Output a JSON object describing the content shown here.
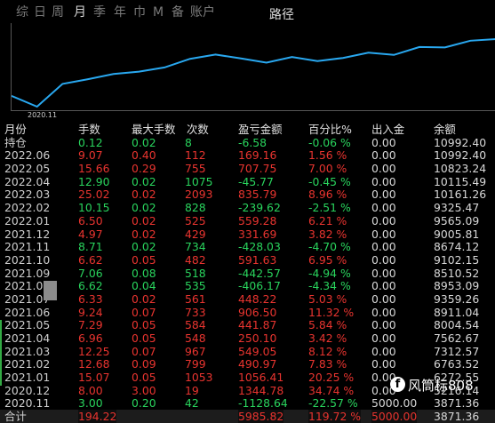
{
  "tabs": [
    "综",
    "日",
    "周",
    "月",
    "季",
    "年",
    "巾",
    "M",
    "备",
    "账户"
  ],
  "active_tab": "月",
  "route_label": "路径",
  "chart_data": {
    "type": "line",
    "x_tick_label": "2020.11",
    "color": "#29a8f0",
    "values": [
      5000.0,
      3871.36,
      6272.55,
      6763.52,
      7312.57,
      7562.67,
      8004.54,
      8911.04,
      9359.26,
      8953.09,
      8510.52,
      9102.15,
      8674.12,
      9005.81,
      9565.09,
      9325.47,
      10161.26,
      10115.49,
      10823.24,
      10992.4
    ]
  },
  "table": {
    "headers": [
      "月份",
      "手数",
      "最大手数",
      "次数",
      "盈亏金额",
      "百分比%",
      "出入金",
      "余额"
    ],
    "rows": [
      {
        "month": "持仓",
        "lots": "0.12",
        "maxlots": "0.02",
        "count": "8",
        "pnl": "-6.58",
        "pct": "-0.06 %",
        "io": "0.00",
        "balance": "10992.40",
        "sign": "neg"
      },
      {
        "month": "2022.06",
        "lots": "9.07",
        "maxlots": "0.40",
        "count": "112",
        "pnl": "169.16",
        "pct": "1.56 %",
        "io": "0.00",
        "balance": "10992.40",
        "sign": "pos"
      },
      {
        "month": "2022.05",
        "lots": "15.66",
        "maxlots": "0.29",
        "count": "755",
        "pnl": "707.75",
        "pct": "7.00 %",
        "io": "0.00",
        "balance": "10823.24",
        "sign": "pos"
      },
      {
        "month": "2022.04",
        "lots": "12.90",
        "maxlots": "0.02",
        "count": "1075",
        "pnl": "-45.77",
        "pct": "-0.45 %",
        "io": "0.00",
        "balance": "10115.49",
        "sign": "neg"
      },
      {
        "month": "2022.03",
        "lots": "25.02",
        "maxlots": "0.02",
        "count": "2093",
        "pnl": "835.79",
        "pct": "8.96 %",
        "io": "0.00",
        "balance": "10161.26",
        "sign": "pos"
      },
      {
        "month": "2022.02",
        "lots": "10.15",
        "maxlots": "0.02",
        "count": "828",
        "pnl": "-239.62",
        "pct": "-2.51 %",
        "io": "0.00",
        "balance": "9325.47",
        "sign": "neg"
      },
      {
        "month": "2022.01",
        "lots": "6.50",
        "maxlots": "0.02",
        "count": "525",
        "pnl": "559.28",
        "pct": "6.21 %",
        "io": "0.00",
        "balance": "9565.09",
        "sign": "pos"
      },
      {
        "month": "2021.12",
        "lots": "4.97",
        "maxlots": "0.02",
        "count": "429",
        "pnl": "331.69",
        "pct": "3.82 %",
        "io": "0.00",
        "balance": "9005.81",
        "sign": "pos"
      },
      {
        "month": "2021.11",
        "lots": "8.71",
        "maxlots": "0.02",
        "count": "734",
        "pnl": "-428.03",
        "pct": "-4.70 %",
        "io": "0.00",
        "balance": "8674.12",
        "sign": "neg"
      },
      {
        "month": "2021.10",
        "lots": "6.62",
        "maxlots": "0.05",
        "count": "482",
        "pnl": "591.63",
        "pct": "6.95 %",
        "io": "0.00",
        "balance": "9102.15",
        "sign": "pos"
      },
      {
        "month": "2021.09",
        "lots": "7.06",
        "maxlots": "0.08",
        "count": "518",
        "pnl": "-442.57",
        "pct": "-4.94 %",
        "io": "0.00",
        "balance": "8510.52",
        "sign": "neg"
      },
      {
        "month": "2021.08",
        "lots": "6.62",
        "maxlots": "0.04",
        "count": "535",
        "pnl": "-406.17",
        "pct": "-4.34 %",
        "io": "0.00",
        "balance": "8953.09",
        "sign": "neg"
      },
      {
        "month": "2021.07",
        "lots": "6.33",
        "maxlots": "0.02",
        "count": "561",
        "pnl": "448.22",
        "pct": "5.03 %",
        "io": "0.00",
        "balance": "9359.26",
        "sign": "pos"
      },
      {
        "month": "2021.06",
        "lots": "9.24",
        "maxlots": "0.07",
        "count": "733",
        "pnl": "906.50",
        "pct": "11.32 %",
        "io": "0.00",
        "balance": "8911.04",
        "sign": "pos"
      },
      {
        "month": "2021.05",
        "lots": "7.29",
        "maxlots": "0.05",
        "count": "584",
        "pnl": "441.87",
        "pct": "5.84 %",
        "io": "0.00",
        "balance": "8004.54",
        "sign": "pos"
      },
      {
        "month": "2021.04",
        "lots": "6.96",
        "maxlots": "0.05",
        "count": "548",
        "pnl": "250.10",
        "pct": "3.42 %",
        "io": "0.00",
        "balance": "7562.67",
        "sign": "pos"
      },
      {
        "month": "2021.03",
        "lots": "12.25",
        "maxlots": "0.07",
        "count": "967",
        "pnl": "549.05",
        "pct": "8.12 %",
        "io": "0.00",
        "balance": "7312.57",
        "sign": "pos"
      },
      {
        "month": "2021.02",
        "lots": "12.68",
        "maxlots": "0.09",
        "count": "799",
        "pnl": "490.97",
        "pct": "7.83 %",
        "io": "0.00",
        "balance": "6763.52",
        "sign": "pos"
      },
      {
        "month": "2021.01",
        "lots": "15.07",
        "maxlots": "0.05",
        "count": "1053",
        "pnl": "1056.41",
        "pct": "20.25 %",
        "io": "0.00",
        "balance": "6272.55",
        "sign": "pos"
      },
      {
        "month": "2020.12",
        "lots": "8.00",
        "maxlots": "3.00",
        "count": "19",
        "pnl": "1344.78",
        "pct": "34.74 %",
        "io": "0.00",
        "balance": "5216.14",
        "sign": "pos"
      },
      {
        "month": "2020.11",
        "lots": "3.00",
        "maxlots": "0.20",
        "count": "42",
        "pnl": "-1128.64",
        "pct": "-22.57 %",
        "io": "5000.00",
        "balance": "3871.36",
        "sign": "neg"
      }
    ],
    "total": {
      "month": "合计",
      "lots": "194.22",
      "maxlots": "",
      "count": "",
      "pnl": "5985.82",
      "pct": "119.72 %",
      "io": "5000.00",
      "balance": "3871.36"
    }
  },
  "watermark": {
    "icon": "f",
    "text": "风筒标808"
  },
  "colors": {
    "positive": "#e8342f",
    "negative": "#29d45d",
    "line": "#29a8f0"
  }
}
